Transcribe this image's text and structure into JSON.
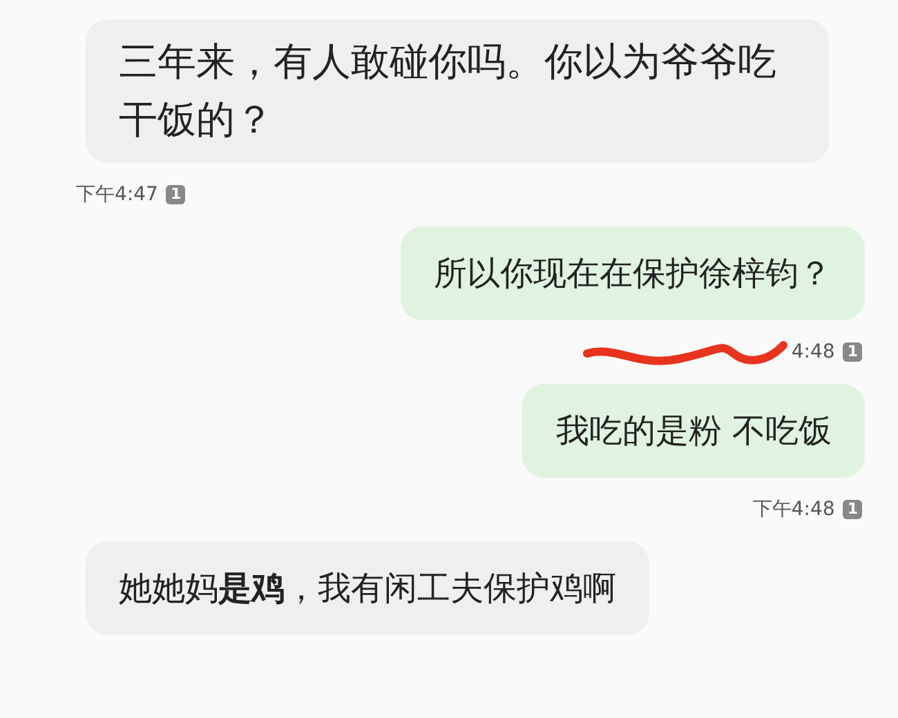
{
  "messages": [
    {
      "kind": "received",
      "text": "三年来，有人敢碰你吗。你以为爷爷吃干饭的？",
      "time": "下午4:47",
      "sim": "1",
      "scribbled": false
    },
    {
      "kind": "sent",
      "text": "所以你现在在保护徐梓钧？",
      "time": "4:48",
      "sim": "1",
      "scribbled": true
    },
    {
      "kind": "sent",
      "text": "我吃的是粉 不吃饭",
      "time": "下午4:48",
      "sim": "1",
      "scribbled": false
    },
    {
      "kind": "received",
      "text": "她她妈**是鸡**，我有闲工夫保护鸡啊"
    }
  ]
}
